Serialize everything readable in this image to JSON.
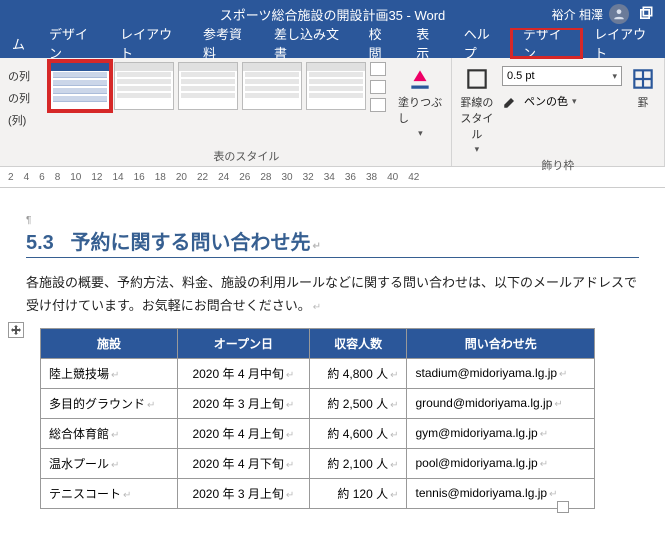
{
  "title": "スポーツ総合施設の開設計画35 - Word",
  "user": {
    "name": "裕介 相澤"
  },
  "tabs": [
    "ム",
    "デザイン",
    "レイアウト",
    "参考資料",
    "差し込み文書",
    "校閲",
    "表示",
    "ヘルプ",
    "デザイン",
    "レイアウト"
  ],
  "highlight_tab_index": 8,
  "ribbon": {
    "left_opts": [
      "の列",
      "の列",
      "(列)"
    ],
    "styles_group_label": "表のスタイル",
    "shading_label": "塗りつぶし",
    "border_style_label": "罫線の\nスタイル",
    "pt_value": "0.5 pt",
    "pen_color_label": "ペンの色",
    "borders_group_label": "飾り枠",
    "border_btn": "罫"
  },
  "ruler_vals": [
    "2",
    "4",
    "6",
    "8",
    "10",
    "12",
    "14",
    "16",
    "18",
    "20",
    "22",
    "24",
    "26",
    "28",
    "30",
    "32",
    "34",
    "36",
    "38",
    "40",
    "42"
  ],
  "doc": {
    "heading_num": "5.3",
    "heading_text": "予約に関する問い合わせ先",
    "paragraph": "各施設の概要、予約方法、料金、施設の利用ルールなどに関する問い合わせは、以下のメールアドレスで受け付けています。お気軽にお問合せください。",
    "table": {
      "headers": [
        "施設",
        "オープン日",
        "収容人数",
        "問い合わせ先"
      ],
      "rows": [
        {
          "name": "陸上競技場",
          "open": "2020 年 4 月中旬",
          "cap": "約 4,800 人",
          "contact": "stadium@midoriyama.lg.jp"
        },
        {
          "name": "多目的グラウンド",
          "open": "2020 年 3 月上旬",
          "cap": "約 2,500 人",
          "contact": "ground@midoriyama.lg.jp"
        },
        {
          "name": "総合体育館",
          "open": "2020 年 4 月上旬",
          "cap": "約 4,600 人",
          "contact": "gym@midoriyama.lg.jp"
        },
        {
          "name": "温水プール",
          "open": "2020 年 4 月下旬",
          "cap": "約 2,100 人",
          "contact": "pool@midoriyama.lg.jp"
        },
        {
          "name": "テニスコート",
          "open": "2020 年 3 月上旬",
          "cap": "約 120 人",
          "contact": "tennis@midoriyama.lg.jp"
        }
      ]
    }
  }
}
